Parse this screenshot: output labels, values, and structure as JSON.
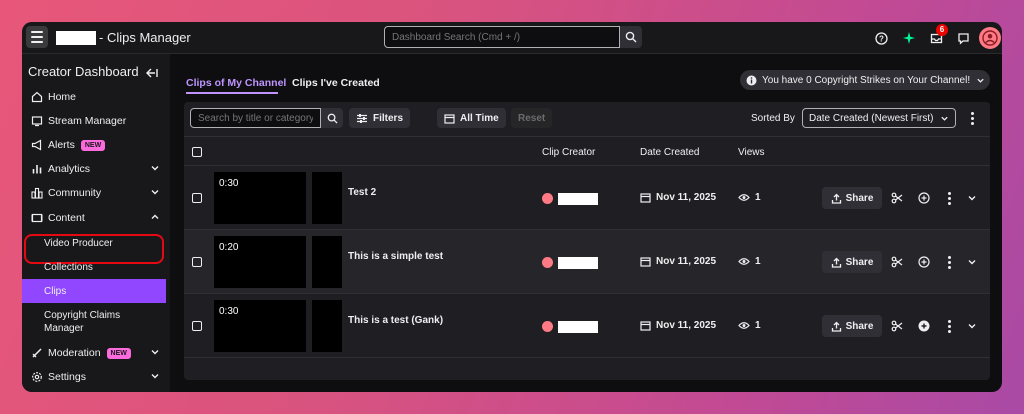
{
  "topbar": {
    "title": "- Clips Manager",
    "search_placeholder": "Dashboard Search (Cmd + /)",
    "notification_count": "6"
  },
  "sidebar": {
    "header": "Creator Dashboard",
    "items": [
      {
        "label": "Home",
        "icon": "home-icon"
      },
      {
        "label": "Stream Manager",
        "icon": "stream-manager-icon"
      },
      {
        "label": "Alerts",
        "icon": "megaphone-icon",
        "badge": "NEW"
      },
      {
        "label": "Analytics",
        "icon": "analytics-icon"
      },
      {
        "label": "Community",
        "icon": "community-icon"
      },
      {
        "label": "Content",
        "icon": "content-icon"
      },
      {
        "label": "Moderation",
        "icon": "sword-icon",
        "badge": "NEW"
      },
      {
        "label": "Settings",
        "icon": "gear-icon"
      }
    ],
    "content_sub": [
      "Video Producer",
      "Collections",
      "Clips",
      "Copyright Claims",
      "Manager"
    ]
  },
  "tabs": [
    "Clips of My Channel",
    "Clips I've Created"
  ],
  "copyright_notice": "You have 0 Copyright Strikes on Your Channel!",
  "toolbar": {
    "search_placeholder": "Search by title or category",
    "filters": "Filters",
    "all_time": "All Time",
    "reset": "Reset",
    "sorted_by": "Sorted By",
    "sort_value": "Date Created (Newest First)"
  },
  "columns": [
    "Clip Creator",
    "Date Created",
    "Views"
  ],
  "clips": [
    {
      "duration": "0:30",
      "title": "Test 2",
      "date": "Nov 11, 2025",
      "views": "1"
    },
    {
      "duration": "0:20",
      "title": "This is a simple test",
      "date": "Nov 11, 2025",
      "views": "1"
    },
    {
      "duration": "0:30",
      "title": "This is a test (Gank)",
      "date": "Nov 11, 2025",
      "views": "1"
    }
  ],
  "share_label": "Share",
  "colors": {
    "accent": "#9147ff",
    "tab_underline": "#bf94ff",
    "new_badge": "#fc6bde",
    "highlight": "#e50914"
  }
}
